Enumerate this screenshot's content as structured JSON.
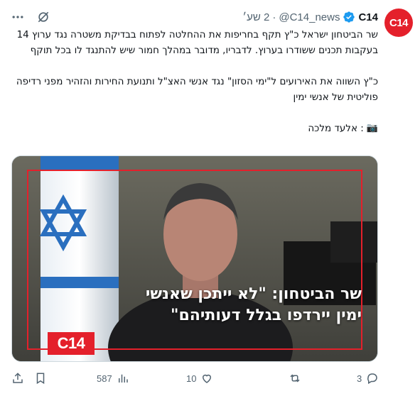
{
  "author": {
    "display_name": "C14",
    "handle": "@C14_news",
    "avatar_text": "C14",
    "verified": true,
    "time": "2 שע׳",
    "separator": "·"
  },
  "tweet": {
    "para1": "שר הביטחון ישראל כ\"ץ תקף בחריפות את ההחלטה לפתוח בבדיקת משטרה נגד ערוץ 14 בעקבות תכנים ששודרו בערוץ. לדבריו, מדובר במהלך חמור שיש להתנגד לו בכל תוקף",
    "para2": "כ\"ץ השווה את האירועים ל\"ימי הסזון\" נגד אנשי האצ\"ל ותנועת החירות והזהיר מפני רדיפה פוליטית של אנשי ימין",
    "credit_text": ": אלעד מלכה",
    "camera_icon": "camera-icon"
  },
  "media": {
    "overlay_line1": "שר הביטחון: \"לא ייתכן שאנשי",
    "overlay_line2": "ימין יירדפו בגלל דעותיהם\"",
    "logo_text": "C14"
  },
  "actions": {
    "replies": "3",
    "retweets": "",
    "likes": "10",
    "views": "587"
  },
  "colors": {
    "brand_red": "#e4202b",
    "verified_blue": "#1d9bf0",
    "muted_text": "#536471",
    "text": "#0f1419"
  }
}
